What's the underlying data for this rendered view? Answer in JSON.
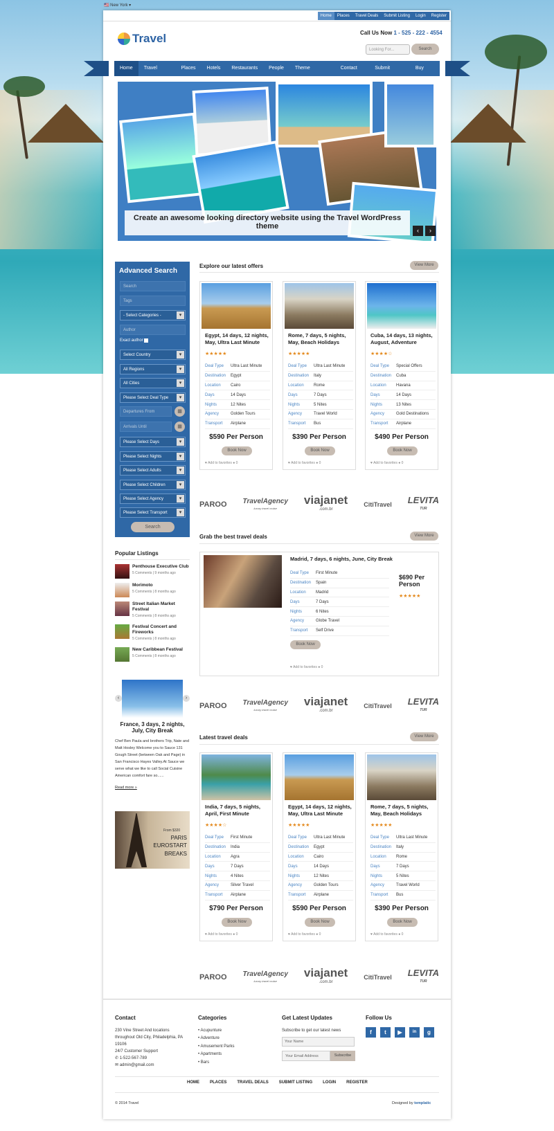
{
  "topstrip": {
    "location": "New York"
  },
  "toplinks": [
    "Home",
    "Places",
    "Travel Deals",
    "Submit Listing",
    "Login",
    "Register"
  ],
  "brand": {
    "name": "Travel"
  },
  "header": {
    "call_label": "Call Us Now",
    "phone": "1 - 525 - 222 - 4554",
    "search_placeholder": "Looking For...",
    "search_button": "Search"
  },
  "nav": [
    "Home",
    "Travel Deals",
    "Places",
    "Hotels",
    "Restaurants",
    "People",
    "Theme Features",
    "Contact Us",
    "Submit Listing",
    "Buy Now"
  ],
  "slider": {
    "caption": "Create an awesome looking directory website using the Travel WordPress theme",
    "prev": "‹",
    "next": "›"
  },
  "advanced": {
    "title": "Advanced Search",
    "search": "Search",
    "tags": "Tags",
    "categories": "- Select Categories -",
    "author": "Author",
    "exact": "Exact author",
    "country": "Select Country",
    "regions": "All Regions",
    "cities": "All Cities",
    "dealtype": "Please Select Deal Type",
    "from": "Departures From",
    "until": "Arrivals Until",
    "days": "Please Select Days",
    "nights": "Please Select Nights",
    "adults": "Please Select Adults",
    "children": "Please Select Children",
    "agency": "Please Select Agency",
    "transport": "Please Select Transport",
    "button": "Search"
  },
  "labels": {
    "deal_type": "Deal Type",
    "destination": "Destination",
    "location": "Location",
    "days": "Days",
    "nights": "Nights",
    "agency": "Agency",
    "transport": "Transport",
    "book": "Book Now",
    "fav": "Add to favorites",
    "comments": "0",
    "view_more": "View More"
  },
  "offers": {
    "title": "Explore our latest offers",
    "cards": [
      {
        "title": "Egypt, 14 days, 12 nights, May, Ultra Last Minute",
        "stars": "★★★★★",
        "deal_type": "Ultra Last Minute",
        "destination": "Egypt",
        "location": "Cairo",
        "days": "14 Days",
        "nights": "12 Nites",
        "agency": "Golden Tours",
        "transport": "Airplane",
        "price": "$590 Per Person"
      },
      {
        "title": "Rome, 7 days, 5 nights, May, Beach Holidays",
        "stars": "★★★★★",
        "deal_type": "Ultra Last Minute",
        "destination": "Italy",
        "location": "Rome",
        "days": "7 Days",
        "nights": "5 Nites",
        "agency": "Travel World",
        "transport": "Bus",
        "price": "$390 Per Person"
      },
      {
        "title": "Cuba, 14 days, 13 nights, August, Adventure",
        "stars": "★★★★☆",
        "deal_type": "Special Offers",
        "destination": "Cuba",
        "location": "Havana",
        "days": "14 Days",
        "nights": "13 Nites",
        "agency": "Gold Destinations",
        "transport": "Airplane",
        "price": "$490 Per Person"
      }
    ]
  },
  "partners": [
    "PAROO",
    "TravelAgency",
    "viajanet",
    "CitiTravel",
    "LEVITA"
  ],
  "partner_subs": [
    "",
    "luxury travel cruise",
    ".com.br",
    "",
    "TUR"
  ],
  "best": {
    "title": "Grab the best travel deals",
    "item": {
      "title": "Madrid, 7 days, 6 nights, June, City Break",
      "deal_type": "First Minute",
      "destination": "Spain",
      "location": "Madrid",
      "days": "7 Days",
      "nights": "6 Nites",
      "agency": "Globe Travel",
      "transport": "Self Drive",
      "price": "$690 Per Person",
      "stars": "★★★★★"
    }
  },
  "latest": {
    "title": "Latest travel deals",
    "cards": [
      {
        "title": "India, 7 days, 5 nights, April, First Minute",
        "stars": "★★★★☆",
        "deal_type": "First Minute",
        "destination": "India",
        "location": "Agra",
        "days": "7 Days",
        "nights": "4 Nites",
        "agency": "Silver Travel",
        "transport": "Airplane",
        "price": "$790 Per Person"
      },
      {
        "title": "Egypt, 14 days, 12 nights, May, Ultra Last Minute",
        "stars": "★★★★★",
        "deal_type": "Ultra Last Minute",
        "destination": "Egypt",
        "location": "Cairo",
        "days": "14 Days",
        "nights": "12 Nites",
        "agency": "Golden Tours",
        "transport": "Airplane",
        "price": "$590 Per Person"
      },
      {
        "title": "Rome, 7 days, 5 nights, May, Beach Holidays",
        "stars": "★★★★★",
        "deal_type": "Ultra Last Minute",
        "destination": "Italy",
        "location": "Rome",
        "days": "7 Days",
        "nights": "5 Nites",
        "agency": "Travel World",
        "transport": "Bus",
        "price": "$390 Per Person"
      }
    ]
  },
  "popular": {
    "title": "Popular Listings",
    "items": [
      {
        "name": "Penthouse Executive Club",
        "comments": "5 Comments",
        "ago": "9 months ago"
      },
      {
        "name": "Morimoto",
        "comments": "5 Comments",
        "ago": "8 months ago"
      },
      {
        "name": "Street Italian Market Festival",
        "comments": "5 Comments",
        "ago": "8 months ago"
      },
      {
        "name": "Festival Concert and Fireworks",
        "comments": "5 Comments",
        "ago": "8 months ago"
      },
      {
        "name": "New Caribbean Festival",
        "comments": "5 Comments",
        "ago": "8 months ago"
      }
    ]
  },
  "featured": {
    "title": "France, 3 days, 2 nights, July, City Break",
    "text": "Chef Ben Paula and brothers Trip, Nate and Matt Hosley Welcome you to Sauce 131 Gough Street (between Oak and Page) in San Francisco Hayes Valley.At Sauce we serve what we like to call Social Cuisine American comfort fare so......",
    "more": "Read more »"
  },
  "ad": {
    "from": "From $320",
    "line1": "PARIS",
    "line2": "EUROSTART",
    "line3": "BREAKS"
  },
  "footer": {
    "contact_title": "Contact",
    "address": "230 Vine Street And locations throughout Old City, Philadelphia, PA 19106",
    "support": "24/7 Customer Support",
    "phone": "1-522-567-789",
    "email": "admin@gmail.com",
    "cat_title": "Categories",
    "cats": [
      "Acupunture",
      "Adventure",
      "Amusement Parks",
      "Apartments",
      "Bars"
    ],
    "upd_title": "Get Latest Updates",
    "upd_text": "Subscribe to get our latest news",
    "name_ph": "Your Name",
    "email_ph": "Your Email Address",
    "subscribe": "Subscribe",
    "follow_title": "Follow Us",
    "social": [
      "f",
      "t",
      "▶",
      "in",
      "g"
    ],
    "links": [
      "HOME",
      "PLACES",
      "TRAVEL DEALS",
      "SUBMIT LISTING",
      "LOGIN",
      "REGISTER"
    ],
    "copy": "© 2014 Travel",
    "designed": "Designed by",
    "designer": "templatic"
  }
}
